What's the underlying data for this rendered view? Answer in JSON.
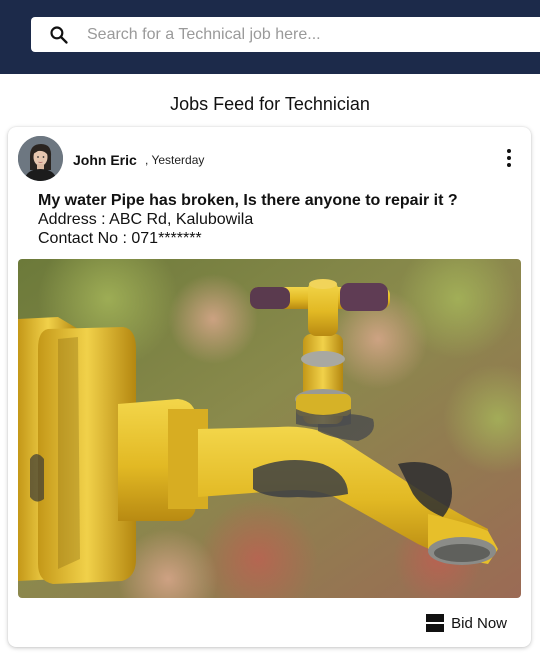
{
  "search": {
    "placeholder": "Search for a Technical job here...",
    "icon": "search-icon"
  },
  "feed": {
    "title": "Jobs Feed for Technician"
  },
  "post": {
    "author": "John Eric",
    "time": ", Yesterday",
    "title": "My water Pipe has broken, Is there anyone to repair it ?",
    "address": "Address : ABC Rd, Kalubowila",
    "contact": "Contact No : 071*******",
    "bid_label": "Bid Now"
  },
  "colors": {
    "header": "#1c2a4a",
    "faucet": "#e8c230"
  }
}
